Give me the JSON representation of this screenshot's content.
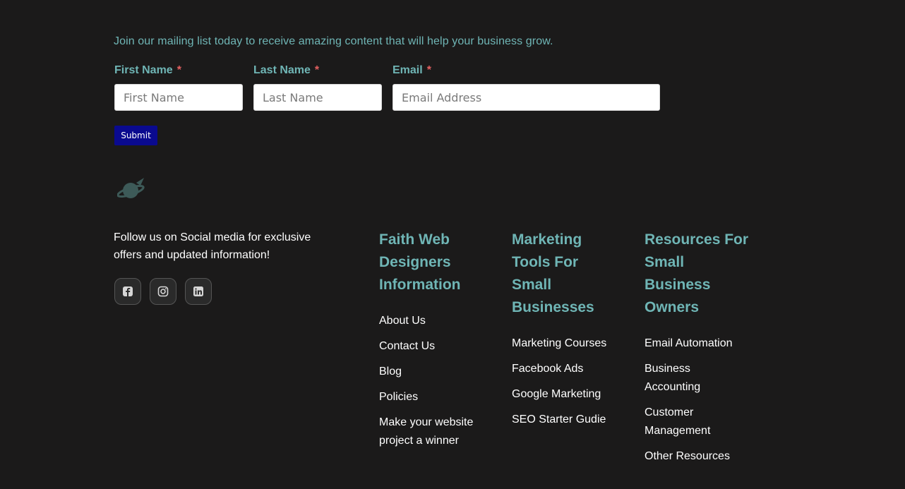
{
  "newsletter": {
    "intro": "Join our mailing list today to receive amazing content that will help your business grow.",
    "fields": [
      {
        "label": "First Name",
        "required_mark": "*",
        "placeholder": "First Name"
      },
      {
        "label": "Last Name",
        "required_mark": "*",
        "placeholder": "Last Name"
      },
      {
        "label": "Email",
        "required_mark": "*",
        "placeholder": "Email Address"
      }
    ],
    "submit_label": "Submit"
  },
  "colors": {
    "background": "#1b1a1a",
    "accent": "#6fb5b5",
    "required": "#e36060",
    "submit": "#0a0a8f"
  },
  "logo_icon": "planet-rocket-icon",
  "footer": {
    "follow_text": "Follow us on Social media for exclusive offers and updated information!",
    "social": [
      {
        "icon": "facebook-icon"
      },
      {
        "icon": "instagram-icon"
      },
      {
        "icon": "linkedin-icon"
      }
    ],
    "columns": [
      {
        "heading": "Faith Web Designers Information",
        "links": [
          "About Us",
          "Contact Us",
          "Blog",
          "Policies",
          "Make your website project a winner"
        ]
      },
      {
        "heading": "Marketing Tools For Small Businesses",
        "links": [
          "Marketing Courses",
          "Facebook Ads",
          "Google Marketing",
          "SEO Starter Gudie"
        ]
      },
      {
        "heading": "Resources For Small Business Owners",
        "links": [
          "Email Automation",
          "Business Accounting",
          "Customer Management",
          "Other Resources"
        ]
      }
    ]
  }
}
